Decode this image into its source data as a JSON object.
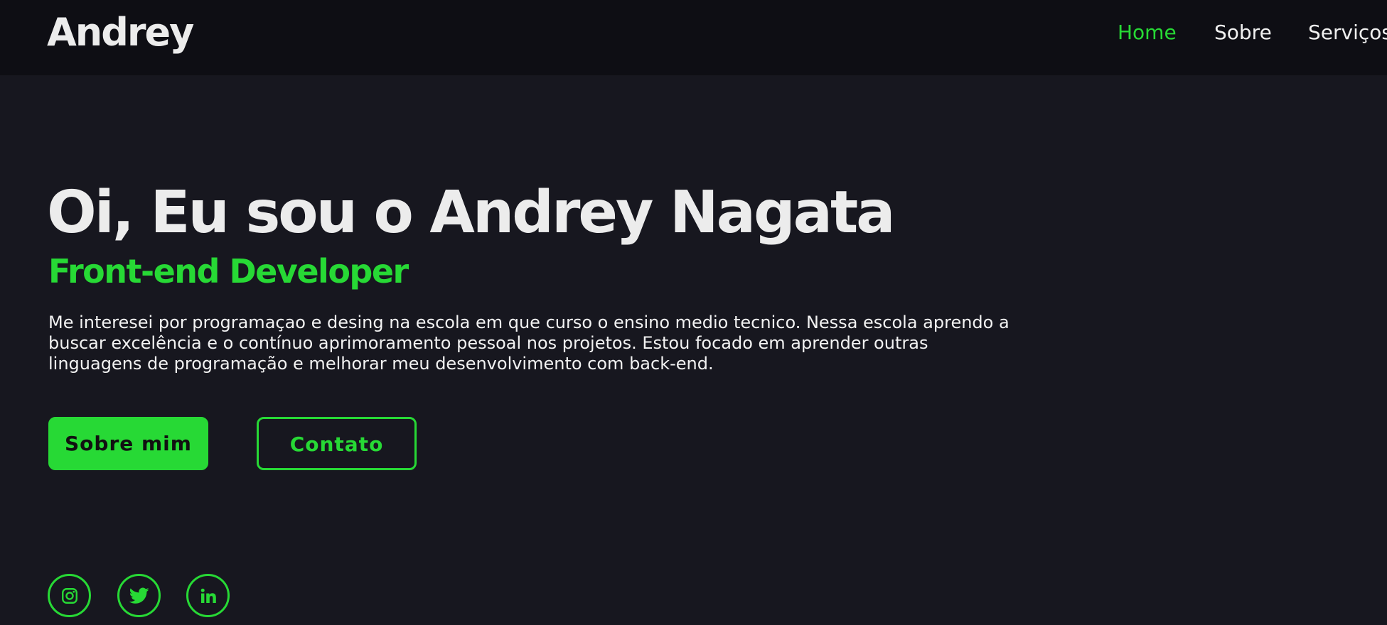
{
  "brand": {
    "logo_text": "Andrey"
  },
  "nav": {
    "items": [
      {
        "label": "Home",
        "active": true
      },
      {
        "label": "Sobre",
        "active": false
      },
      {
        "label": "Serviços",
        "active": false
      }
    ]
  },
  "hero": {
    "title": "Oi, Eu sou o Andrey Nagata",
    "subtitle": "Front-end Developer",
    "description": "Me interesei por programaçao e desing na escola em que curso o ensino medio tecnico. Nessa escola aprendo a buscar excelência e o contínuo aprimoramento pessoal nos projetos. Estou focado em aprender outras linguagens de programação e melhorar meu desenvolvimento com back-end.",
    "primary_button_label": "Sobre mim",
    "secondary_button_label": "Contato"
  },
  "social": {
    "icons": [
      "instagram-icon",
      "twitter-icon",
      "linkedin-icon"
    ]
  },
  "colors": {
    "accent": "#27d935",
    "background": "#17171f",
    "header_background": "#0e0e14",
    "text": "#ececec"
  }
}
